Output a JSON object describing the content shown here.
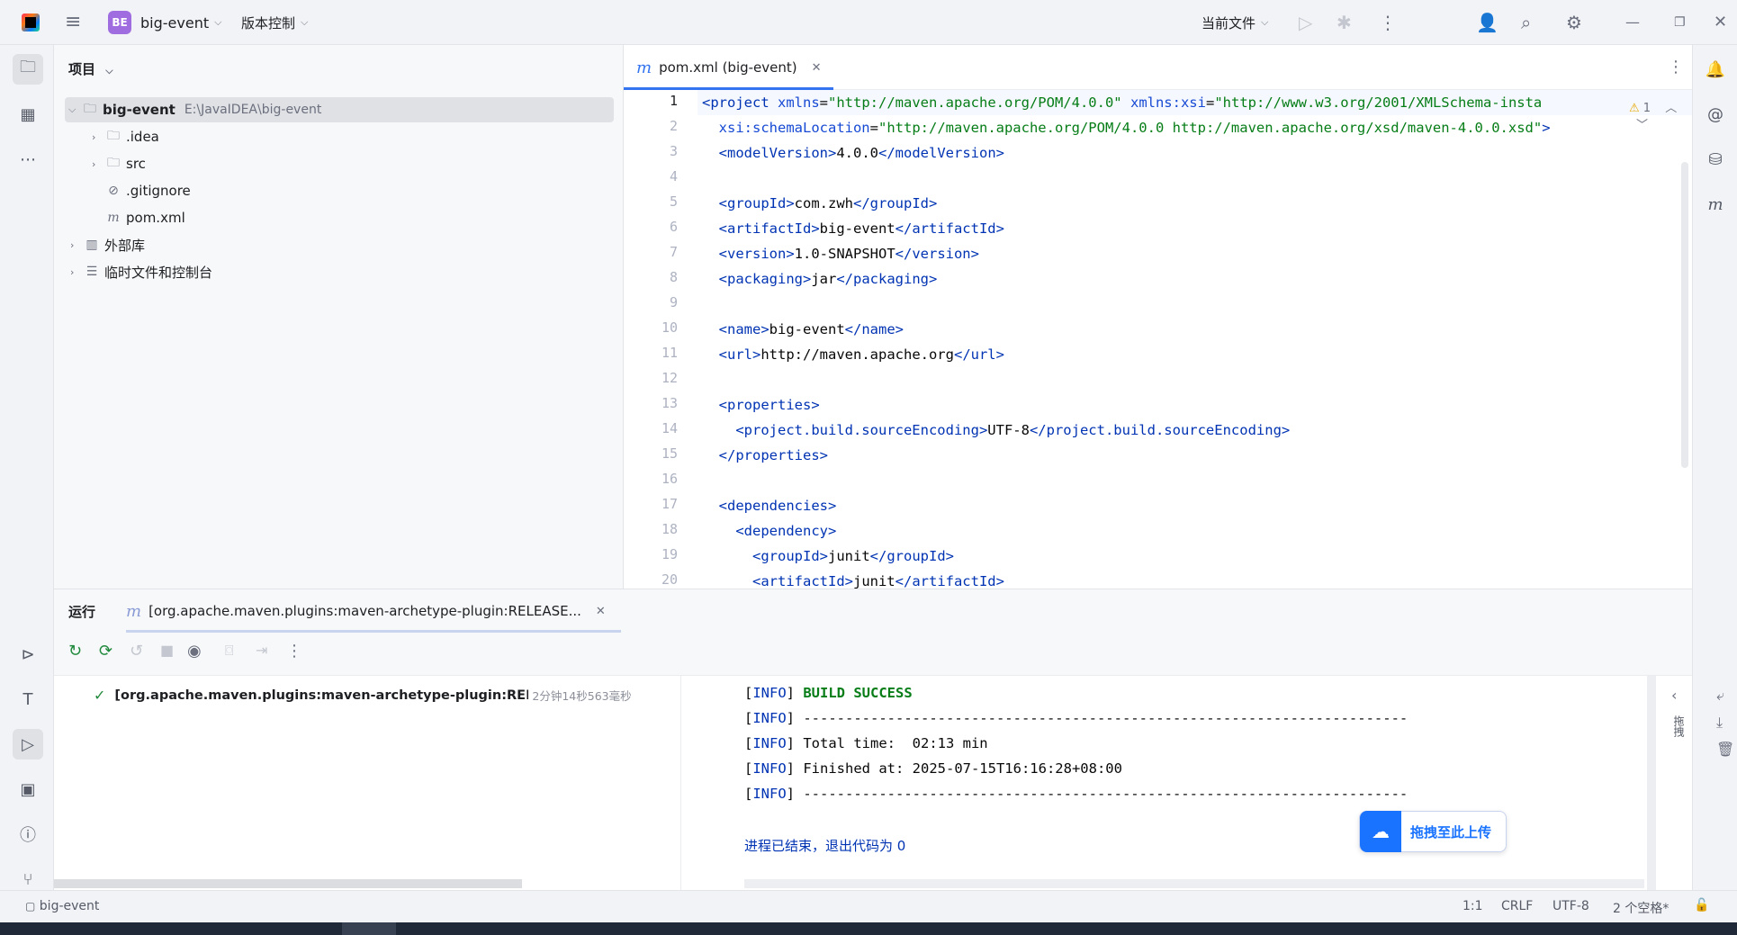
{
  "titlebar": {
    "project_badge": "BE",
    "project_name": "big-event",
    "vcs_label": "版本控制",
    "run_config": "当前文件"
  },
  "project_panel": {
    "title": "项目",
    "root": {
      "name": "big-event",
      "path": "E:\\JavaIDEA\\big-event"
    },
    "children": [
      {
        "name": ".idea",
        "icon": "folder-icon"
      },
      {
        "name": "src",
        "icon": "folder-icon"
      },
      {
        "name": ".gitignore",
        "icon": "ignore-file-icon"
      },
      {
        "name": "pom.xml",
        "icon": "maven-icon"
      }
    ],
    "external_libs": "外部库",
    "scratches": "临时文件和控制台"
  },
  "editor": {
    "tab_label": "pom.xml (big-event)",
    "warning_count": "1",
    "line_numbers": [
      "1",
      "2",
      "3",
      "4",
      "5",
      "6",
      "7",
      "8",
      "9",
      "10",
      "11",
      "12",
      "13",
      "14",
      "15",
      "16",
      "17",
      "18",
      "19",
      "20"
    ]
  },
  "run_panel": {
    "tab_run": "运行",
    "run_config_tab": "[org.apache.maven.plugins:maven-archetype-plugin:RELEASE...",
    "tree_item": "[org.apache.maven.plugins:maven-archetype-plugin:RELEASE:g",
    "tree_item_time": "2分钟14秒563毫秒",
    "console": {
      "info_tag": "INFO",
      "build_success": "BUILD SUCCESS",
      "dashes": "------------------------------------------------------------------------",
      "total_time": "Total time:  02:13 min",
      "finished_at": "Finished at: 2025-07-15T16:16:28+08:00",
      "exit_message": "进程已结束，退出代码为 0"
    },
    "side_label": "拖拽",
    "upload_button": "拖拽至此上传"
  },
  "statusbar": {
    "project": "big-event",
    "position": "1:1",
    "line_sep": "CRLF",
    "encoding": "UTF-8",
    "indent": "2 个空格*"
  }
}
